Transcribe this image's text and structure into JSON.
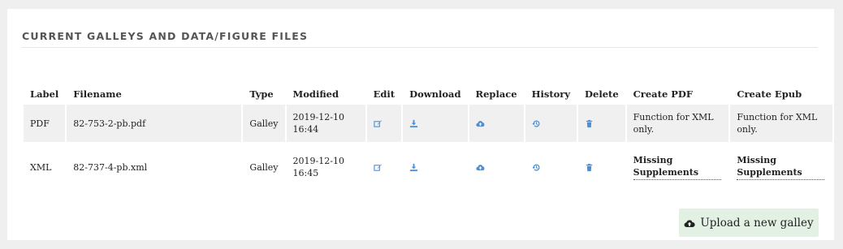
{
  "section": {
    "title": "CURRENT GALLEYS AND DATA/FIGURE FILES"
  },
  "table": {
    "headers": [
      "Label",
      "Filename",
      "Type",
      "Modified",
      "Edit",
      "Download",
      "Replace",
      "History",
      "Delete",
      "Create PDF",
      "Create Epub"
    ],
    "rows": [
      {
        "label": "PDF",
        "filename": "82-753-2-pb.pdf",
        "type": "Galley",
        "modified_date": "2019-12-10",
        "modified_time": "16:44",
        "create_pdf": "Function for XML only.",
        "create_epub": "Function for XML only."
      },
      {
        "label": "XML",
        "filename": "82-737-4-pb.xml",
        "type": "Galley",
        "modified_date": "2019-12-10",
        "modified_time": "16:45",
        "create_pdf": "Missing Supplements",
        "create_epub": "Missing Supplements"
      }
    ],
    "icons": {
      "edit": "edit-icon",
      "download": "download-icon",
      "replace": "cloud-upload-icon",
      "history": "history-icon",
      "delete": "trash-icon"
    }
  },
  "upload_button": {
    "label": "Upload a new galley",
    "icon": "cloud-upload-icon"
  },
  "colors": {
    "icon_blue": "#4a90d9",
    "button_bg": "#e3f1e5",
    "row_stripe": "#f0f0f0"
  }
}
